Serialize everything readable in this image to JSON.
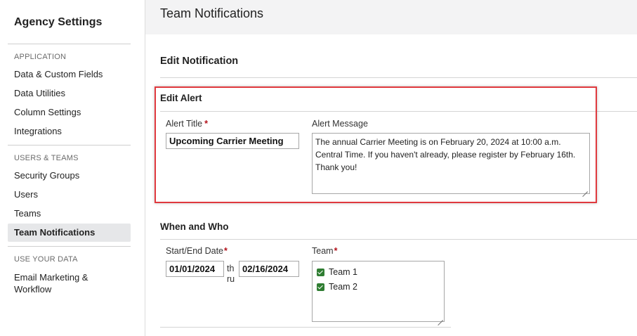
{
  "sidebar": {
    "title": "Agency Settings",
    "sections": [
      {
        "heading": "APPLICATION",
        "items": [
          "Data & Custom Fields",
          "Data Utilities",
          "Column Settings",
          "Integrations"
        ]
      },
      {
        "heading": "USERS & TEAMS",
        "items": [
          "Security Groups",
          "Users",
          "Teams",
          "Team Notifications"
        ]
      },
      {
        "heading": "USE YOUR DATA",
        "items": [
          "Email Marketing & Workflow"
        ]
      }
    ],
    "active_item": "Team Notifications"
  },
  "page": {
    "title": "Team Notifications"
  },
  "edit_notification": {
    "title": "Edit Notification"
  },
  "edit_alert": {
    "title": "Edit Alert",
    "alert_title_label": "Alert Title",
    "alert_title_required": "*",
    "alert_title_value": "Upcoming Carrier Meeting",
    "alert_message_label": "Alert Message",
    "alert_message_value": "The annual Carrier Meeting is on February 20, 2024 at 10:00 a.m. Central Time. If you haven't already, please register by February 16th. Thank you!"
  },
  "when_who": {
    "title": "When and Who",
    "date_label": "Start/End Date",
    "date_required": "*",
    "start_date": "01/01/2024",
    "thru_line1": "th",
    "thru_line2": "ru",
    "end_date": "02/16/2024",
    "team_label": "Team",
    "team_required": "*",
    "teams": [
      {
        "label": "Team 1",
        "checked": true
      },
      {
        "label": "Team 2",
        "checked": true
      }
    ]
  },
  "colors": {
    "highlight_border": "#e0393e",
    "required_marker": "#b3121b",
    "checkbox_checked": "#2f7d32",
    "active_item_bg": "#e6e7e9",
    "topbar_bg": "#f3f3f4"
  },
  "icons": {
    "checkbox": "checkmark-icon",
    "resize": "resize-grip-icon"
  }
}
